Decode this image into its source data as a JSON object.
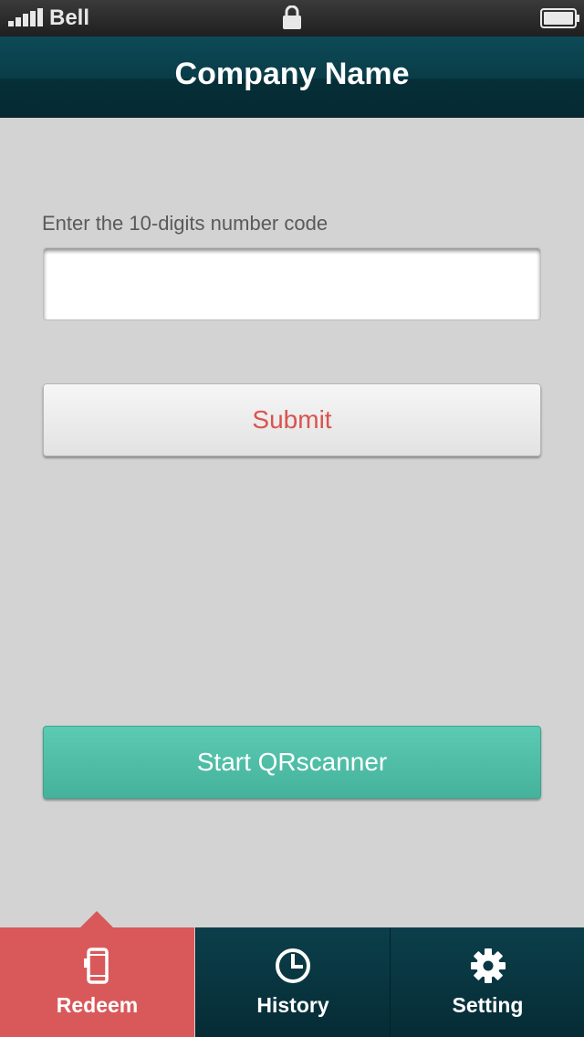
{
  "status_bar": {
    "carrier": "Bell",
    "signal_icon": "signal-bars-icon",
    "lock_icon": "lock-icon",
    "battery_icon": "battery-icon"
  },
  "header": {
    "title": "Company Name"
  },
  "form": {
    "code_label": "Enter the 10-digits number code",
    "code_value": "",
    "submit_label": "Submit",
    "qr_label": "Start QRscanner"
  },
  "tab_bar": {
    "tabs": [
      {
        "label": "Redeem",
        "icon": "phone-icon",
        "active": true
      },
      {
        "label": "History",
        "icon": "clock-icon",
        "active": false
      },
      {
        "label": "Setting",
        "icon": "gear-icon",
        "active": false
      }
    ]
  },
  "colors": {
    "background": "#d3d3d3",
    "header": "#093d48",
    "accent_red": "#d9595a",
    "submit_text": "#d9534f",
    "qr_button": "#52bfa7"
  }
}
